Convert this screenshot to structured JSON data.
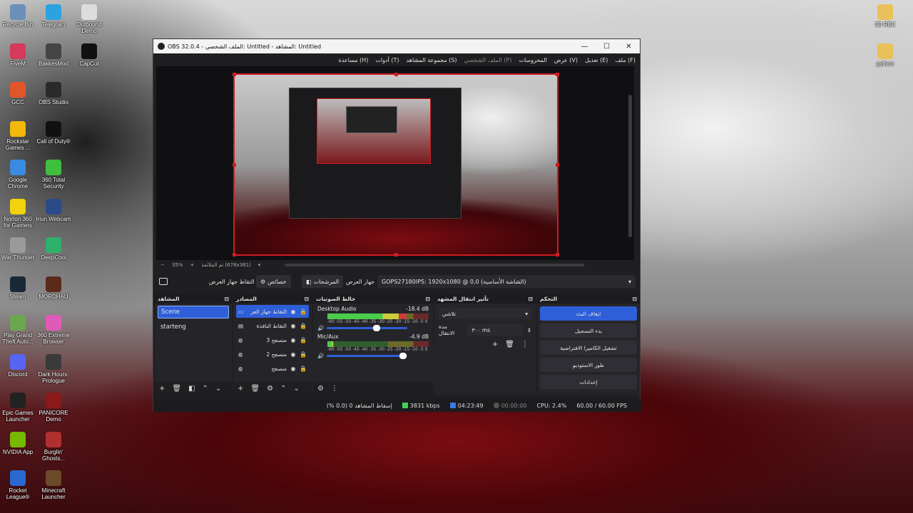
{
  "desktop": {
    "icons_left": [
      {
        "label": "Recycle Bin",
        "icon": "recycle-bin-icon",
        "color": "#6a8fb8"
      },
      {
        "label": "FiveM",
        "icon": "fivem-icon",
        "color": "#d43a5a"
      },
      {
        "label": "GCC",
        "icon": "gcc-icon",
        "color": "#e0552a"
      },
      {
        "label": "Rockstar Games ...",
        "icon": "rockstar-icon",
        "color": "#f2b80c"
      },
      {
        "label": "Google Chrome",
        "icon": "chrome-icon",
        "color": "#3a8be0"
      },
      {
        "label": "Norton 360 for Gamers",
        "icon": "norton-icon",
        "color": "#f2d20c"
      },
      {
        "label": "War Thunder",
        "icon": "war-thunder-icon",
        "color": "#9a9a9a"
      },
      {
        "label": "Steam",
        "icon": "steam-icon",
        "color": "#1b2838"
      },
      {
        "label": "Play Grand Theft Auto...",
        "icon": "gta-icon",
        "color": "#6aa84f"
      },
      {
        "label": "Discord",
        "icon": "discord-icon",
        "color": "#5865f2"
      },
      {
        "label": "Epic Games Launcher",
        "icon": "epic-icon",
        "color": "#222222"
      },
      {
        "label": "NVIDIA App",
        "icon": "nvidia-icon",
        "color": "#76b900"
      },
      {
        "label": "Rocket League®",
        "icon": "rocket-league-icon",
        "color": "#2a6ad0"
      }
    ],
    "icons_second": [
      {
        "label": "Telegram",
        "icon": "telegram-icon",
        "color": "#2aa3e0"
      },
      {
        "label": "BakkesMod",
        "icon": "bakkesmod-icon",
        "color": "#444444"
      },
      {
        "label": "OBS Studio",
        "icon": "obs-icon",
        "color": "#2a2a2a"
      },
      {
        "label": "Call of Duty®",
        "icon": "cod-icon",
        "color": "#111111"
      },
      {
        "label": "360 Total Security",
        "icon": "360-icon",
        "color": "#3fbf3f"
      },
      {
        "label": "Iriun Webcam",
        "icon": "iriun-icon",
        "color": "#2a4a8a"
      },
      {
        "label": "DeepCool",
        "icon": "deepcool-icon",
        "color": "#2fb06a"
      },
      {
        "label": "MORDHAU",
        "icon": "mordhau-icon",
        "color": "#5a2a1a"
      },
      {
        "label": "360 Extreme Browser",
        "icon": "360-browser-icon",
        "color": "#e05ab8"
      },
      {
        "label": "Dark Hours: Prologue",
        "icon": "dark-hours-icon",
        "color": "#3a3a3a"
      },
      {
        "label": "PANICORE Demo",
        "icon": "panicore-icon",
        "color": "#8a1a1a"
      },
      {
        "label": "Burglin' Ghosts...",
        "icon": "burglin-icon",
        "color": "#b03030"
      },
      {
        "label": "Minecraft Launcher",
        "icon": "minecraft-icon",
        "color": "#6b4a2a"
      }
    ],
    "icons_third": [
      {
        "label": "Outbound Demo",
        "icon": "outbound-icon",
        "color": "#dddddd"
      },
      {
        "label": "CapCut",
        "icon": "capcut-icon",
        "color": "#111111"
      }
    ],
    "icons_right": [
      {
        "label": "3D RBC",
        "icon": "folder-grid-icon",
        "color": "#e8c15a"
      },
      {
        "label": "python",
        "icon": "folder-icon",
        "color": "#e8c15a"
      }
    ]
  },
  "window": {
    "title": "OBS 32.0.4 - الملف الشخصي: Untitled - المشاهد: Untitled",
    "controls": {
      "minimize": "—",
      "maximize": "☐",
      "close": "✕"
    }
  },
  "menu": [
    {
      "label": "ملف (F)",
      "dim": false
    },
    {
      "label": "تعديل (E)",
      "dim": false
    },
    {
      "label": "عرض (V)",
      "dim": false
    },
    {
      "label": "المحروسات",
      "dim": false
    },
    {
      "label": "الملف الشخصي (P)",
      "dim": true
    },
    {
      "label": "مجموعة المشاهد (S)",
      "dim": false
    },
    {
      "label": "أدوات (T)",
      "dim": false
    },
    {
      "label": "مساعدة (H)",
      "dim": false
    }
  ],
  "zoombar": {
    "minus": "−",
    "zoom": "35%",
    "plus": "+",
    "fit_label": "تم الملائمة (678x381)"
  },
  "source_bar": {
    "source_name": "التقاط جهاز العرض",
    "properties": "خصائص",
    "filters": "المرشحات",
    "device_label": "جهاز العرض",
    "device_value": "GOPS27180IPS: 1920x1080 @ 0,0 (الشاشة الأساسية)"
  },
  "scenes": {
    "title": "المشاهد",
    "items": [
      {
        "label": "Scene",
        "selected": true
      },
      {
        "label": "starteng",
        "selected": false
      }
    ]
  },
  "sources": {
    "title": "المصادر",
    "items": [
      {
        "label": "التقاط جهاز العر",
        "icon": "monitor-icon",
        "selected": true
      },
      {
        "label": "التقاط النافذة",
        "icon": "window-icon",
        "selected": false
      },
      {
        "label": "متصفح 3",
        "icon": "globe-icon",
        "selected": false
      },
      {
        "label": "متصفح 2",
        "icon": "globe-icon",
        "selected": false
      },
      {
        "label": "متصفح",
        "icon": "globe-icon",
        "selected": false
      }
    ]
  },
  "mixer": {
    "title": "خالط الصوتيات",
    "ticks": "-60 -55 -50 -45 -40 -35 -30 -25 -20 -15 -10 -5 0",
    "channels": [
      {
        "name": "Desktop Audio",
        "db": "-18.4 dB",
        "level": 0.78,
        "volume": 0.62
      },
      {
        "name": "Mic/Aux",
        "db": "-4.9 dB",
        "level": 0.06,
        "volume": 0.95
      }
    ]
  },
  "transitions": {
    "title": "تأثير انتقال المشهد",
    "type": "تلاشي",
    "duration_label": "مدة الانتقال",
    "duration_value": "٣٠٠ ms"
  },
  "controls": {
    "title": "التحكم",
    "buttons": [
      {
        "label": "ايقاف البث",
        "primary": true
      },
      {
        "label": "بدء التسجيل",
        "primary": false
      },
      {
        "label": "تشغيل الكاميرا الافتراضية",
        "primary": false
      },
      {
        "label": "طور الاستوديو",
        "primary": false
      },
      {
        "label": "إعدادات",
        "primary": false
      }
    ]
  },
  "status": {
    "dropped": "إسقاط المشاهد 0 (0.0 %)",
    "bitrate": "3831 kbps",
    "stream_time": "04:23:49",
    "rec_time": "00:00:00",
    "cpu": "CPU: 2.4%",
    "fps": "60.00 / 60.00 FPS"
  },
  "colors": {
    "accent": "#2f5fd8",
    "preview_border": "#d01a22",
    "bitrate_green": "#3fcf5a"
  }
}
